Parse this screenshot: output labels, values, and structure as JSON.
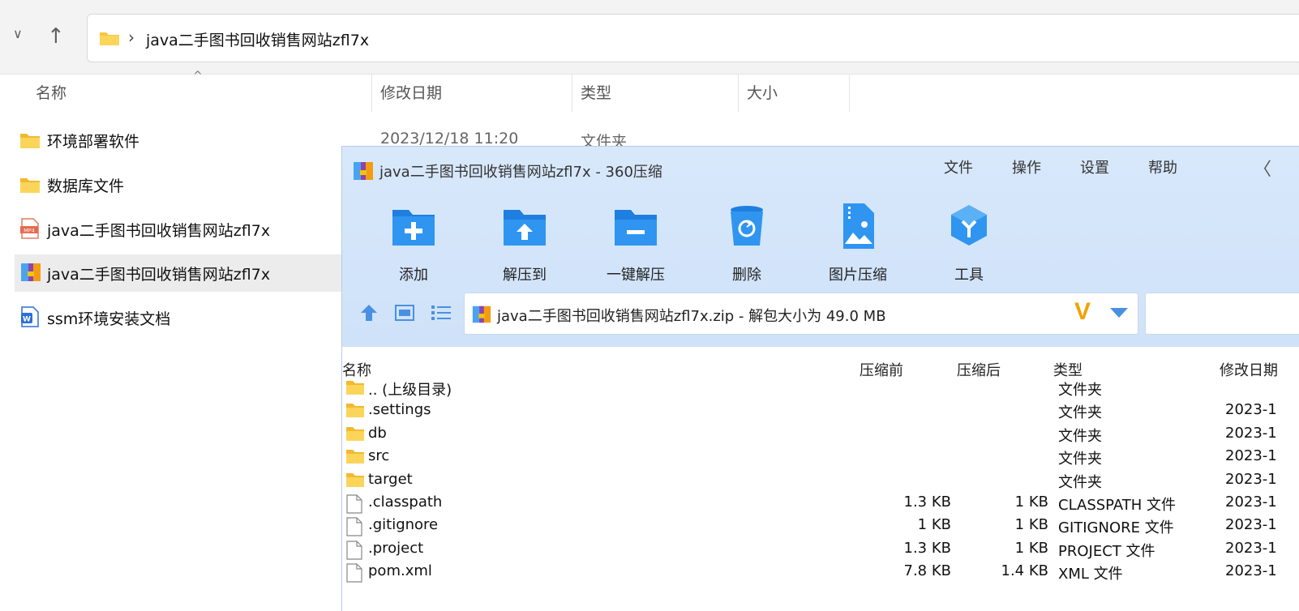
{
  "explorer": {
    "address_path": "java二手图书回收销售网站zfl7x",
    "columns": {
      "name": "名称",
      "date": "修改日期",
      "type": "类型",
      "size": "大小"
    },
    "rows": [
      {
        "label": "环境部署软件",
        "icon": "folder-icon"
      },
      {
        "label": "数据库文件",
        "icon": "folder-icon"
      },
      {
        "label": "java二手图书回收销售网站zfl7x",
        "icon": "mp4-file-icon"
      },
      {
        "label": "java二手图书回收销售网站zfl7x",
        "icon": "zip-archive-icon"
      },
      {
        "label": "ssm环境安装文档",
        "icon": "word-doc-icon"
      }
    ],
    "first_row_date": "2023/12/18 11:20",
    "first_row_type": "文件夹"
  },
  "zip": {
    "title": "java二手图书回收销售网站zfl7x - 360压缩",
    "menu": [
      "文件",
      "操作",
      "设置",
      "帮助"
    ],
    "toolbar": [
      "添加",
      "解压到",
      "一键解压",
      "删除",
      "图片压缩",
      "工具"
    ],
    "path": "java二手图书回收销售网站zfl7x.zip - 解包大小为 49.0 MB",
    "columns": {
      "name": "名称",
      "before": "压缩前",
      "after": "压缩后",
      "type": "类型",
      "date": "修改日期"
    },
    "rows": [
      {
        "name": ".. (上级目录)",
        "before": "",
        "after": "",
        "type": "文件夹",
        "date": "",
        "icon": "folder-icon"
      },
      {
        "name": ".settings",
        "before": "",
        "after": "",
        "type": "文件夹",
        "date": "2023-1",
        "icon": "folder-icon"
      },
      {
        "name": "db",
        "before": "",
        "after": "",
        "type": "文件夹",
        "date": "2023-1",
        "icon": "folder-icon"
      },
      {
        "name": "src",
        "before": "",
        "after": "",
        "type": "文件夹",
        "date": "2023-1",
        "icon": "folder-icon"
      },
      {
        "name": "target",
        "before": "",
        "after": "",
        "type": "文件夹",
        "date": "2023-1",
        "icon": "folder-icon"
      },
      {
        "name": ".classpath",
        "before": "1.3 KB",
        "after": "1 KB",
        "type": "CLASSPATH 文件",
        "date": "2023-1",
        "icon": "file-icon"
      },
      {
        "name": ".gitignore",
        "before": "1 KB",
        "after": "1 KB",
        "type": "GITIGNORE 文件",
        "date": "2023-1",
        "icon": "file-icon"
      },
      {
        "name": ".project",
        "before": "1.3 KB",
        "after": "1 KB",
        "type": "PROJECT 文件",
        "date": "2023-1",
        "icon": "file-icon"
      },
      {
        "name": "pom.xml",
        "before": "7.8 KB",
        "after": "1.4 KB",
        "type": "XML 文件",
        "date": "2023-1",
        "icon": "file-icon"
      }
    ]
  },
  "colors": {
    "accent": "#1e88e5",
    "folder": "#f6c744",
    "toolbar_bg": "#d4e5fa",
    "selected_row": "#ececec"
  }
}
